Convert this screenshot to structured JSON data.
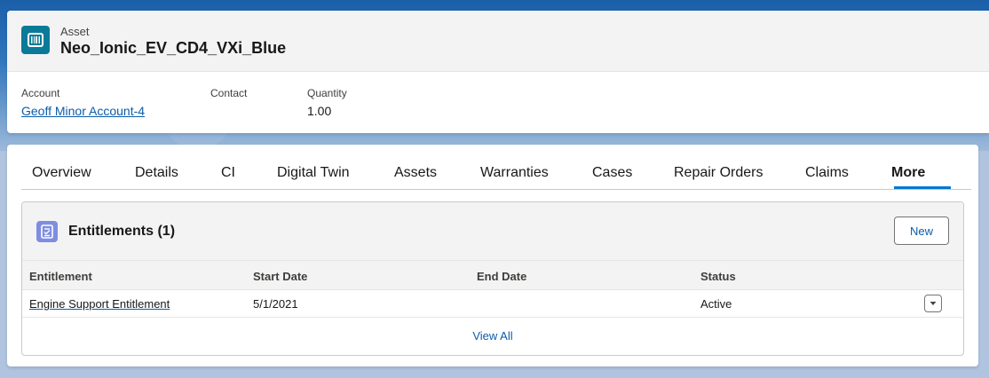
{
  "header": {
    "object_label": "Asset",
    "title": "Neo_Ionic_EV_CD4_VXi_Blue",
    "fields": [
      {
        "label": "Account",
        "value": "Geoff Minor Account-4"
      },
      {
        "label": "Contact",
        "value": ""
      },
      {
        "label": "Quantity",
        "value": "1.00"
      }
    ]
  },
  "tabs": [
    "Overview",
    "Details",
    "CI",
    "Digital Twin",
    "Assets",
    "Warranties",
    "Cases",
    "Repair Orders",
    "Claims",
    "More"
  ],
  "active_tab": "More",
  "related_list": {
    "title": "Entitlements (1)",
    "new_label": "New",
    "columns": [
      "Entitlement",
      "Start Date",
      "End Date",
      "Status"
    ],
    "rows": [
      {
        "entitlement": "Engine Support Entitlement",
        "start_date": "5/1/2021",
        "end_date": "",
        "status": "Active"
      }
    ],
    "view_all_label": "View All"
  },
  "icons": {
    "asset": "asset-barcode-icon",
    "entitlement": "entitlement-icon",
    "row_menu": "chevron-down-icon"
  },
  "colors": {
    "asset_icon": "#0b7a98",
    "entitlement_icon": "#7f8de1",
    "link": "#0b5cab",
    "active_tab_underline": "#0176d3"
  }
}
